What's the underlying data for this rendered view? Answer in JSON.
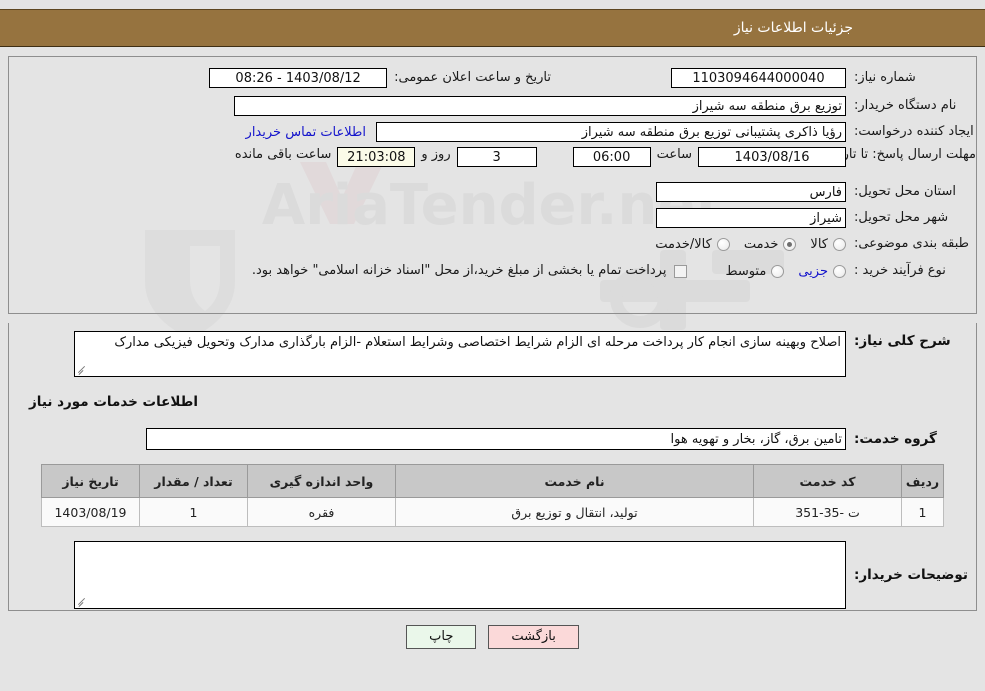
{
  "header": {
    "title": "جزئیات اطلاعات نیاز"
  },
  "form": {
    "need_number_label": "شماره نیاز:",
    "need_number_value": "1103094644000040",
    "announce_label": "تاریخ و ساعت اعلان عمومی:",
    "announce_value": "1403/08/12 - 08:26",
    "buyer_org_label": "نام دستگاه خریدار:",
    "buyer_org_value": "توزیع برق منطقه سه شیراز",
    "creator_label": "ایجاد کننده درخواست:",
    "creator_value": "رؤیا ذاکری پشتیبانی توزیع برق منطقه سه شیراز",
    "contact_link": "اطلاعات تماس خریدار",
    "deadline_label": "مهلت ارسال پاسخ: تا تاریخ:",
    "deadline_date": "1403/08/16",
    "deadline_hour_label": "ساعت",
    "deadline_hour": "06:00",
    "remaining_days": "3",
    "remaining_days_label": "روز و",
    "remaining_time": "21:03:08",
    "remaining_time_label": "ساعت باقی مانده",
    "province_label": "استان محل تحویل:",
    "province_value": "فارس",
    "city_label": "شهر محل تحویل:",
    "city_value": "شیراز",
    "category_label": "طبقه بندی موضوعی:",
    "category_options": [
      {
        "label": "کالا",
        "selected": false
      },
      {
        "label": "خدمت",
        "selected": true
      },
      {
        "label": "کالا/خدمت",
        "selected": false
      }
    ],
    "process_label": "نوع فرآیند خرید :",
    "process_options": [
      {
        "label": "جزیی",
        "selected": false
      },
      {
        "label": "متوسط",
        "selected": false
      }
    ],
    "treasury_note": "پرداخت تمام یا بخشی از مبلغ خرید،از محل \"اسناد خزانه اسلامی\" خواهد بود."
  },
  "description": {
    "label": "شرح کلی نیاز:",
    "value": "اصلاح وبهینه سازی انجام کار پرداخت مرحله ای الزام شرایط اختصاصی وشرایط استعلام -الزام بارگذاری مدارک وتحویل فیزیکی مدارک"
  },
  "services": {
    "section_title": "اطلاعات خدمات مورد نیاز",
    "group_label": "گروه خدمت:",
    "group_value": "تامین برق، گاز، بخار و تهویه هوا",
    "table": {
      "headers": [
        "ردیف",
        "کد خدمت",
        "نام خدمت",
        "واحد اندازه گیری",
        "تعداد / مقدار",
        "تاریخ نیاز"
      ],
      "rows": [
        [
          "1",
          "ت -35-351",
          "تولید، انتقال و توزیع برق",
          "فقره",
          "1",
          "1403/08/19"
        ]
      ]
    }
  },
  "buyer_notes": {
    "label": "توضیحات خریدار:",
    "value": ""
  },
  "footer": {
    "print_label": "چاپ",
    "back_label": "بازگشت"
  },
  "watermark": {
    "text": "AriaTender.net"
  },
  "colors": {
    "header_bg": "#96733f",
    "page_bg": "#e4e4e4",
    "link": "#1414cc",
    "print_btn": "#eaf7ea",
    "back_btn": "#fbd9d9"
  }
}
